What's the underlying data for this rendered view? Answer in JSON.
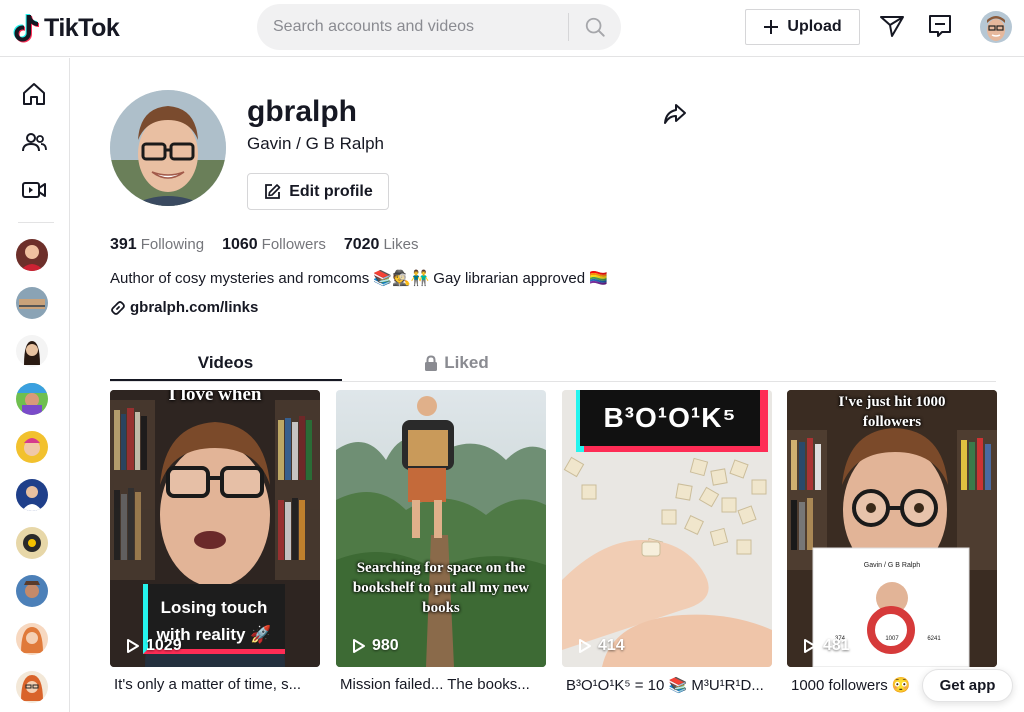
{
  "header": {
    "logo_text": "TikTok",
    "search_placeholder": "Search accounts and videos",
    "upload_label": "Upload"
  },
  "profile": {
    "username": "gbralph",
    "nickname": "Gavin / G B Ralph",
    "edit_label": "Edit profile",
    "stats": [
      {
        "num": "391",
        "label": "Following"
      },
      {
        "num": "1060",
        "label": "Followers"
      },
      {
        "num": "7020",
        "label": "Likes"
      }
    ],
    "bio_text_1": "Author of cosy mysteries and romcoms",
    "bio_emoji": "📚🕵👬",
    "bio_text_2": "Gay librarian approved",
    "bio_flag": "🏳️‍🌈",
    "link": "gbralph.com/links"
  },
  "tabs": {
    "videos": "Videos",
    "liked": "Liked"
  },
  "videos": [
    {
      "views": "1029",
      "caption": "It's only a matter of time, s...",
      "overlay_top": "I love when",
      "overlay_box": "Losing touch with reality 🚀"
    },
    {
      "views": "980",
      "caption": "Mission failed... The books...",
      "overlay_text": "Searching for space on the bookshelf to put all my new books"
    },
    {
      "views": "414",
      "caption": "B³O¹O¹K⁵ = 10 📚 M³U¹R¹D...",
      "overlay_box": "B³O¹O¹K⁵"
    },
    {
      "views": "481",
      "caption": "1000 followers 😳",
      "overlay_top": "I've just hit 1000 followers",
      "mini_name": "Gavin / G B Ralph",
      "mini_followers": "1007",
      "mini_following": "374",
      "mini_likes": "6241"
    }
  ],
  "get_app": "Get app",
  "colors": {
    "brand_red": "#fe2c55",
    "brand_cyan": "#25f4ee",
    "text": "#161823",
    "muted": "#75767b"
  }
}
